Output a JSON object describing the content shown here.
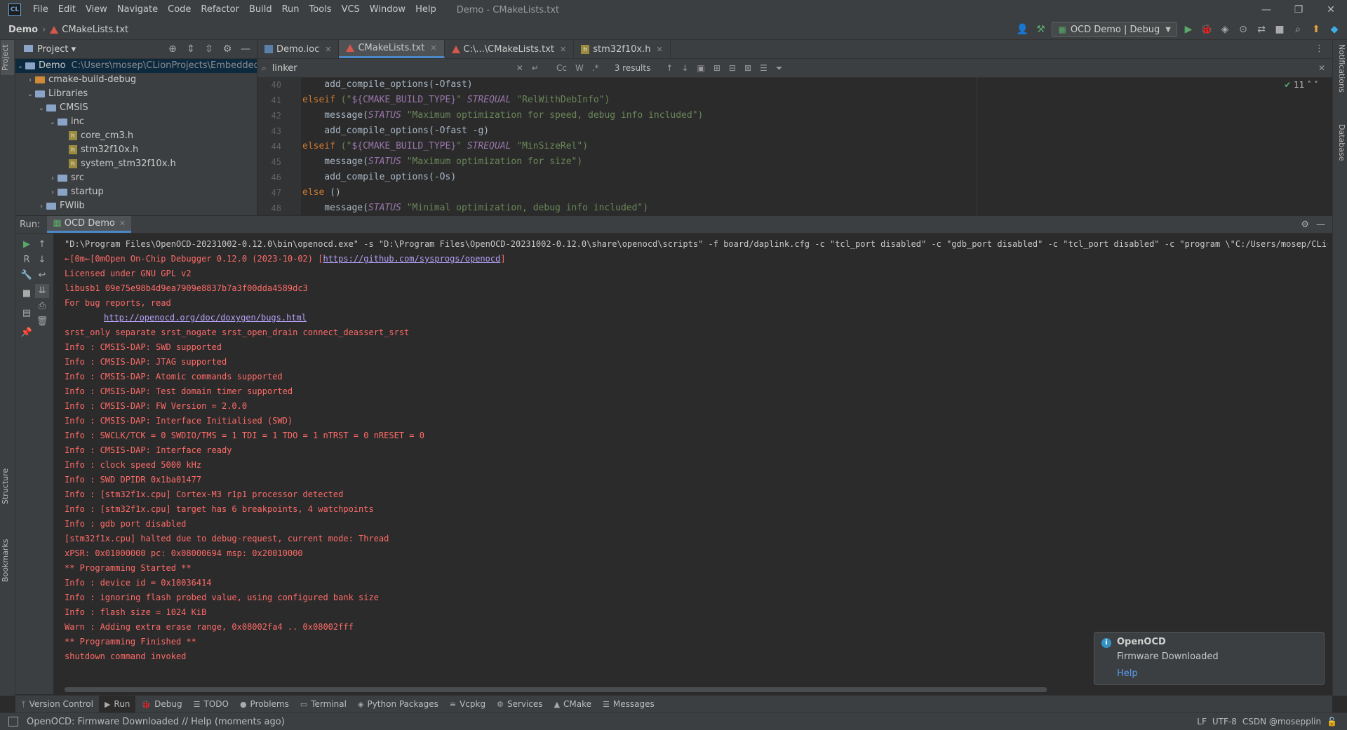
{
  "menu": {
    "logo": "CL",
    "items": [
      "File",
      "Edit",
      "View",
      "Navigate",
      "Code",
      "Refactor",
      "Build",
      "Run",
      "Tools",
      "VCS",
      "Window",
      "Help"
    ],
    "window_title": "Demo - CMakeLists.txt"
  },
  "window_controls": {
    "minimize": "—",
    "restore": "❐",
    "close": "✕"
  },
  "breadcrumb": {
    "project": "Demo",
    "file": "CMakeLists.txt"
  },
  "run_config": {
    "label": "OCD Demo | Debug"
  },
  "project_panel": {
    "title": "Project",
    "tree": [
      {
        "label": "Demo",
        "path": "C:\\Users\\mosep\\CLionProjects\\Embedded\\S"
      },
      {
        "label": "cmake-build-debug"
      },
      {
        "label": "Libraries"
      },
      {
        "label": "CMSIS"
      },
      {
        "label": "inc"
      },
      {
        "label": "core_cm3.h"
      },
      {
        "label": "stm32f10x.h"
      },
      {
        "label": "system_stm32f10x.h"
      },
      {
        "label": "src"
      },
      {
        "label": "startup"
      },
      {
        "label": "FWlib"
      }
    ]
  },
  "editor": {
    "tabs": [
      {
        "label": "Demo.ioc"
      },
      {
        "label": "CMakeLists.txt"
      },
      {
        "label": "C:\\...\\CMakeLists.txt"
      },
      {
        "label": "stm32f10x.h"
      }
    ],
    "search": {
      "value": "linker",
      "results": "3 results",
      "opt_cc": "Cc",
      "opt_w": "W",
      "opt_re": ".*"
    },
    "inspection_count": "11",
    "line_numbers": [
      "40",
      "41",
      "42",
      "43",
      "44",
      "45",
      "46",
      "47",
      "48"
    ],
    "code": {
      "l40": {
        "a": "    add_compile_options(-Ofast)"
      },
      "l41": {
        "kw": "elseif",
        "a": " (\"",
        "var": "${CMAKE_BUILD_TYPE}",
        "b": "\" ",
        "it": "STREQUAL",
        "c": " \"RelWithDebInfo\")"
      },
      "l42": {
        "a": "    message(",
        "it": "STATUS",
        "str": " \"Maximum optimization for speed, debug info included\")"
      },
      "l43": {
        "a": "    add_compile_options(-Ofast -g)"
      },
      "l44": {
        "kw": "elseif",
        "a": " (\"",
        "var": "${CMAKE_BUILD_TYPE}",
        "b": "\" ",
        "it": "STREQUAL",
        "c": " \"MinSizeRel\")"
      },
      "l45": {
        "a": "    message(",
        "it": "STATUS",
        "str": " \"Maximum optimization for size\")"
      },
      "l46": {
        "a": "    add_compile_options(-Os)"
      },
      "l47": {
        "kw": "else",
        "a": " ()"
      },
      "l48": {
        "a": "    message(",
        "it": "STATUS",
        "str": " \"Minimal optimization, debug info included\")"
      }
    }
  },
  "run_panel": {
    "label": "Run:",
    "tab": "OCD Demo",
    "console": {
      "cmd": "\"D:\\Program Files\\OpenOCD-20231002-0.12.0\\bin\\openocd.exe\" -s \"D:\\Program Files\\OpenOCD-20231002-0.12.0\\share\\openocd\\scripts\" -f board/daplink.cfg -c \"tcl_port disabled\" -c \"gdb_port disabled\" -c \"tcl_port disabled\" -c \"program \\\"C:/Users/mosep/CLionProject",
      "l1_prefix": "←[0m←[0mOpen On-Chip Debugger 0.12.0 (2023-10-02) [",
      "l1_link": "https://github.com/sysprogs/openocd",
      "l1_suffix": "]",
      "l2": "Licensed under GNU GPL v2",
      "l3": "libusb1 09e75e98b4d9ea7909e8837b7a3f00dda4589dc3",
      "l4": "For bug reports, read",
      "l5_link": "http://openocd.org/doc/doxygen/bugs.html",
      "l6": "srst_only separate srst_nogate srst_open_drain connect_deassert_srst",
      "l7": "Info : CMSIS-DAP: SWD supported",
      "l8": "Info : CMSIS-DAP: JTAG supported",
      "l9": "Info : CMSIS-DAP: Atomic commands supported",
      "l10": "Info : CMSIS-DAP: Test domain timer supported",
      "l11": "Info : CMSIS-DAP: FW Version = 2.0.0",
      "l12": "Info : CMSIS-DAP: Interface Initialised (SWD)",
      "l13": "Info : SWCLK/TCK = 0 SWDIO/TMS = 1 TDI = 1 TDO = 1 nTRST = 0 nRESET = 0",
      "l14": "Info : CMSIS-DAP: Interface ready",
      "l15": "Info : clock speed 5000 kHz",
      "l16": "Info : SWD DPIDR 0x1ba01477",
      "l17": "Info : [stm32f1x.cpu] Cortex-M3 r1p1 processor detected",
      "l18": "Info : [stm32f1x.cpu] target has 6 breakpoints, 4 watchpoints",
      "l19": "Info : gdb port disabled",
      "l20": "[stm32f1x.cpu] halted due to debug-request, current mode: Thread",
      "l21": "xPSR: 0x01000000 pc: 0x08000694 msp: 0x20010000",
      "l22": "** Programming Started **",
      "l23": "Info : device id = 0x10036414",
      "l24": "Info : ignoring flash probed value, using configured bank size",
      "l25": "Info : flash size = 1024 KiB",
      "l26": "Warn : Adding extra erase range, 0x08002fa4 .. 0x08002fff",
      "l27": "** Programming Finished **",
      "l28": "shutdown command invoked"
    }
  },
  "notification": {
    "title": "OpenOCD",
    "body": "Firmware Downloaded",
    "link": "Help"
  },
  "left_stripe": {
    "project": "Project",
    "structure": "Structure",
    "bookmarks": "Bookmarks"
  },
  "right_stripe": {
    "notifications": "Notifications",
    "database": "Database"
  },
  "bottom_tools": [
    "Version Control",
    "Run",
    "Debug",
    "TODO",
    "Problems",
    "Terminal",
    "Python Packages",
    "Vcpkg",
    "Services",
    "CMake",
    "Messages"
  ],
  "status": {
    "text": "OpenOCD: Firmware Downloaded // Help (moments ago)",
    "lf": "LF",
    "enc": "UTF-8",
    "watermark": "CSDN @mosepplin"
  },
  "colors": {
    "accent": "#4a88c7",
    "console_error": "#ff6b68",
    "link": "#b5a1f6",
    "run_green": "#59a869"
  }
}
